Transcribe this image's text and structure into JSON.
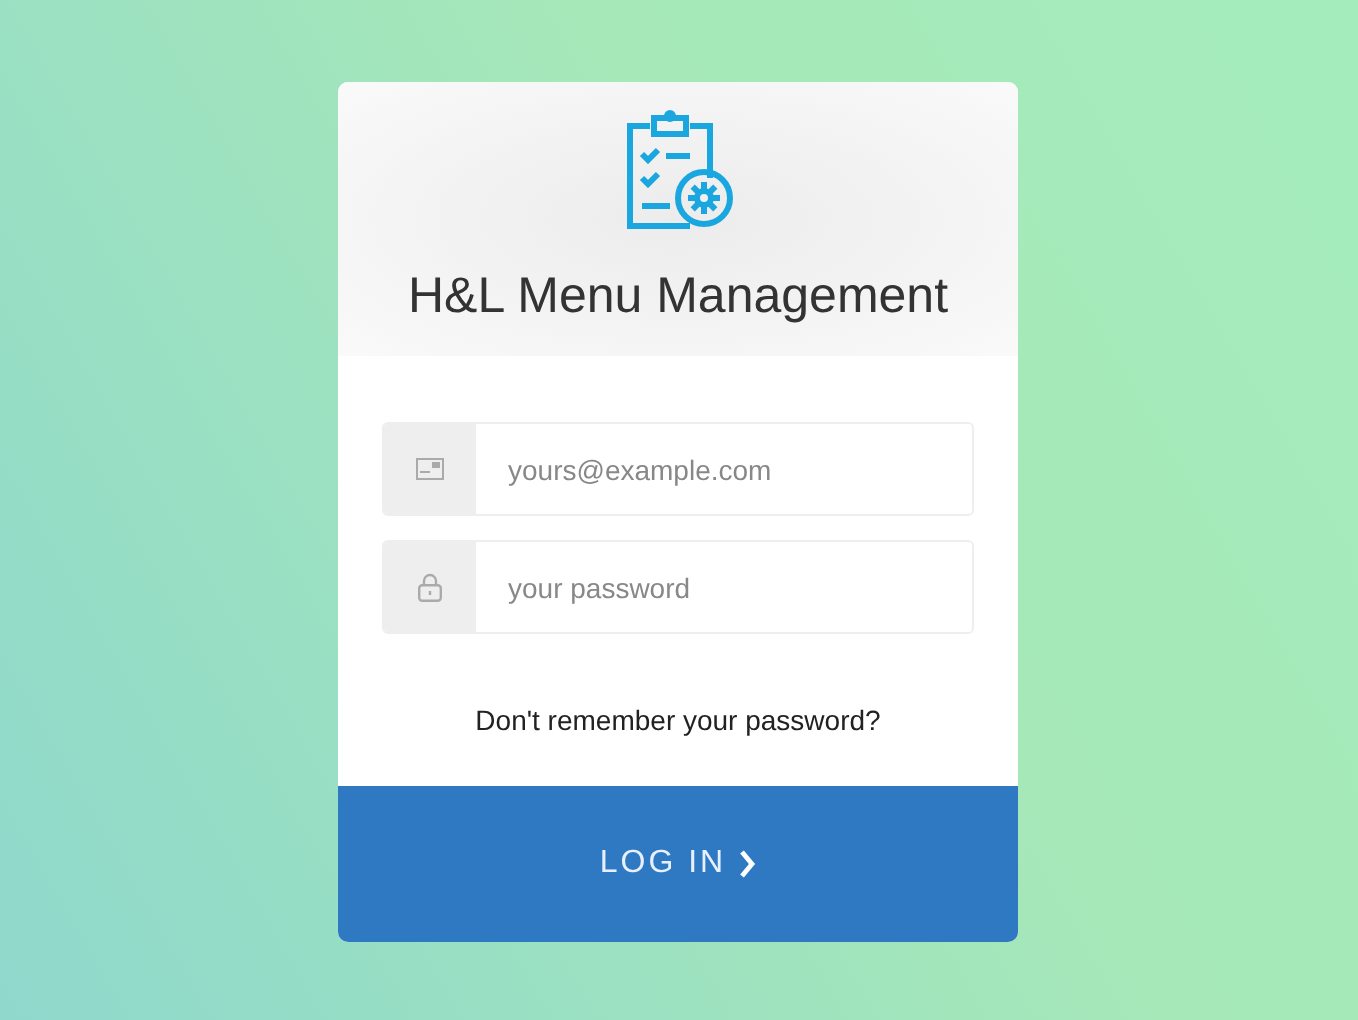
{
  "header": {
    "title": "H&L Menu Management"
  },
  "fields": [
    {
      "kind": "email",
      "placeholder": "yours@example.com"
    },
    {
      "kind": "password",
      "placeholder": "your password"
    }
  ],
  "forgot_link": "Don't remember your password?",
  "submit_button": "LOG IN"
}
